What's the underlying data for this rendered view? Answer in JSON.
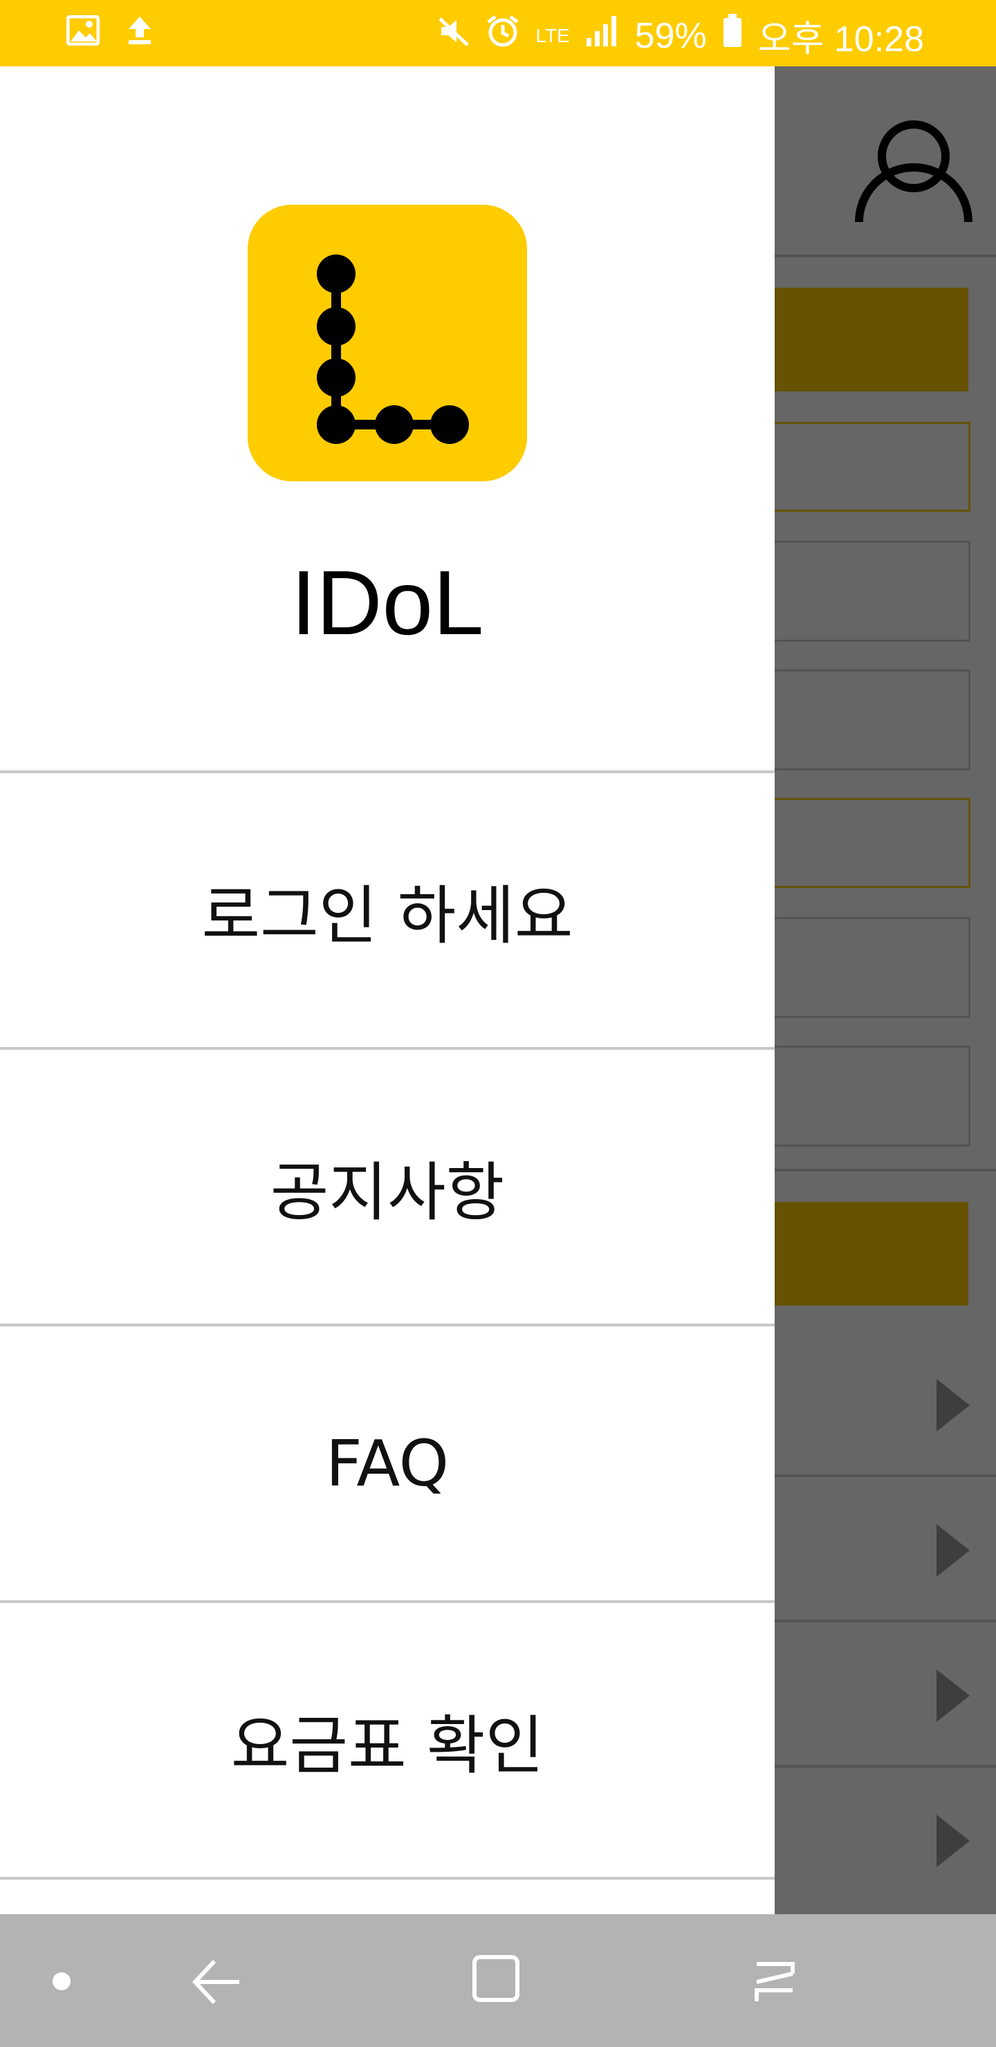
{
  "status_bar": {
    "battery": "59%",
    "time": "오후 10:28",
    "network": "LTE",
    "icons": [
      "image-icon",
      "upload-icon",
      "mute-icon",
      "alarm-icon",
      "lte-icon",
      "signal-icon",
      "battery-icon"
    ]
  },
  "drawer": {
    "app_name": "IDoL",
    "logo_icon": "idol-logo-icon",
    "menu": [
      {
        "label": "로그인 하세요"
      },
      {
        "label": "공지사항"
      },
      {
        "label": "FAQ"
      },
      {
        "label": "요금표 확인"
      }
    ]
  },
  "background": {
    "profile_icon": "profile-icon",
    "row_icon": "play-arrow-icon"
  },
  "nav_bar": {
    "icons": [
      "dot-icon",
      "back-icon",
      "home-icon",
      "recents-icon"
    ]
  },
  "colors": {
    "accent": "#ffcc00",
    "navbar": "#b3b3b3",
    "divider": "#c8c8c8"
  }
}
